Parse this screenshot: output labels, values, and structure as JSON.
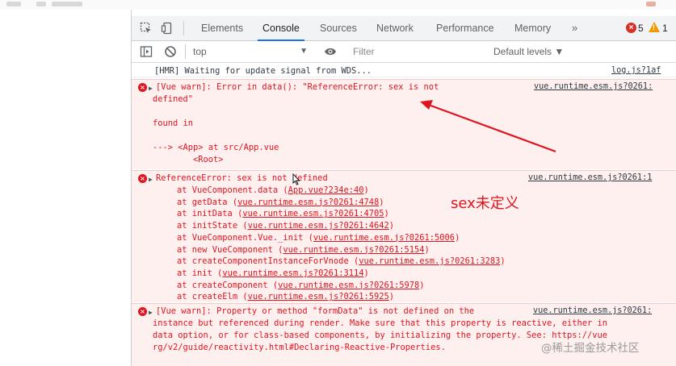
{
  "tabs": [
    "Elements",
    "Console",
    "Sources",
    "Network",
    "Performance",
    "Memory"
  ],
  "more_tabs": "»",
  "errors_count": "5",
  "warnings_count": "1",
  "context": "top",
  "filter_placeholder": "Filter",
  "levels": "Default levels ▼",
  "info": {
    "text": "[HMR] Waiting for update signal from WDS...",
    "source": "log.js?1af"
  },
  "err1": {
    "line1": "[Vue warn]: Error in data(): \"ReferenceError: sex is not",
    "line2": "defined\"",
    "found": "found in",
    "path": "---> <App> at src/App.vue",
    "root": "<Root>",
    "source": "vue.runtime.esm.js?0261:"
  },
  "err2": {
    "head": "ReferenceError: sex is not defined",
    "source": "vue.runtime.esm.js?0261:1",
    "stack": [
      {
        "fn": "at VueComponent.data (",
        "link": "App.vue?234e:40",
        "tail": ")"
      },
      {
        "fn": "at getData (",
        "link": "vue.runtime.esm.js?0261:4748",
        "tail": ")"
      },
      {
        "fn": "at initData (",
        "link": "vue.runtime.esm.js?0261:4705",
        "tail": ")"
      },
      {
        "fn": "at initState (",
        "link": "vue.runtime.esm.js?0261:4642",
        "tail": ")"
      },
      {
        "fn": "at VueComponent.Vue._init (",
        "link": "vue.runtime.esm.js?0261:5006",
        "tail": ")"
      },
      {
        "fn": "at new VueComponent (",
        "link": "vue.runtime.esm.js?0261:5154",
        "tail": ")"
      },
      {
        "fn": "at createComponentInstanceForVnode (",
        "link": "vue.runtime.esm.js?0261:3283",
        "tail": ")"
      },
      {
        "fn": "at init (",
        "link": "vue.runtime.esm.js?0261:3114",
        "tail": ")"
      },
      {
        "fn": "at createComponent (",
        "link": "vue.runtime.esm.js?0261:5978",
        "tail": ")"
      },
      {
        "fn": "at createElm (",
        "link": "vue.runtime.esm.js?0261:5925",
        "tail": ")"
      }
    ]
  },
  "err3": {
    "line1": "[Vue warn]: Property or method \"formData\" is not defined on the",
    "line2": "instance but referenced during render. Make sure that this property is reactive, either in",
    "line3": "data option, or for class-based components, by initializing the property. See: https://vue",
    "line4": "rg/v2/guide/reactivity.html#Declaring-Reactive-Properties.",
    "source": "vue.runtime.esm.js?0261:"
  },
  "annotation": "sex未定义",
  "watermark": "@稀土掘金技术社区",
  "colors": {
    "error": "#e0141e",
    "error_bg": "#fff0f0",
    "accent": "#1a73e8",
    "warning": "#f29900"
  }
}
